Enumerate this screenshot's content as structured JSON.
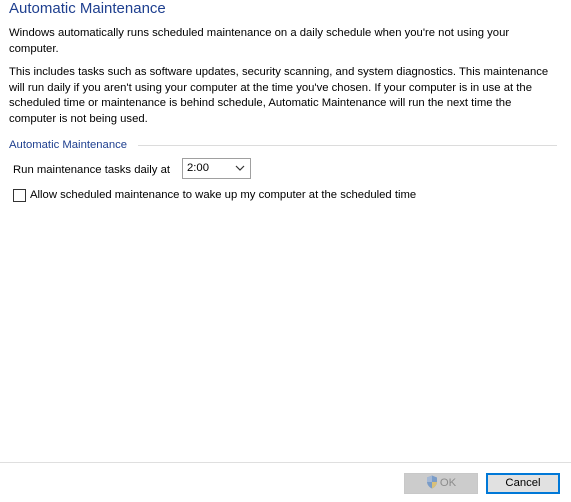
{
  "page": {
    "title": "Automatic Maintenance",
    "intro": "Windows automatically runs scheduled maintenance on a daily schedule when you're not using your computer.",
    "details": "This includes tasks such as software updates, security scanning, and system diagnostics. This maintenance will run daily if you aren't using your computer at the time you've chosen. If your computer is in use at the scheduled time or maintenance is behind schedule, Automatic Maintenance will run the next time the computer is not being used."
  },
  "group": {
    "label": "Automatic Maintenance",
    "run_label": "Run maintenance tasks daily at",
    "time_value": "2:00",
    "wake_label": "Allow scheduled maintenance to wake up my computer at the scheduled time",
    "wake_checked": false
  },
  "buttons": {
    "ok_label": "OK",
    "ok_icon": "uac-shield-icon",
    "cancel_label": "Cancel"
  },
  "colors": {
    "heading": "#1e3f8f",
    "accent": "#0078d7",
    "disabled_bg": "#cccccc"
  }
}
